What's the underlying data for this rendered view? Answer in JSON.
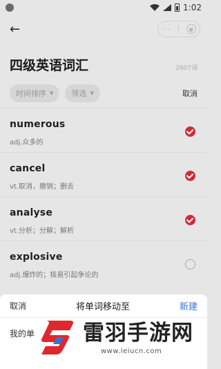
{
  "status": {
    "time": "1:02"
  },
  "header": {
    "back_icon": "back-arrow-icon"
  },
  "page": {
    "title": "四级英语词汇",
    "count": "2607词"
  },
  "filters": {
    "sort_label": "时间排序",
    "filter_label": "筛选",
    "cancel_label": "取消"
  },
  "words": [
    {
      "word": "numerous",
      "meaning": "adj.众多的",
      "checked": true
    },
    {
      "word": "cancel",
      "meaning": "vt.取消，撤销；删去",
      "checked": true
    },
    {
      "word": "analyse",
      "meaning": "vt.分析；分解；解析",
      "checked": true
    },
    {
      "word": "explosive",
      "meaning": "adj.爆炸的；极易引起争论的",
      "checked": false
    }
  ],
  "sheet": {
    "cancel_label": "取消",
    "title": "将单词移动至",
    "new_label": "新建",
    "first_item": "我的单"
  },
  "watermark": {
    "title": "雷羽手游网",
    "url": "www.leiucn.com"
  },
  "colors": {
    "accent_red": "#d12b3a",
    "link_blue": "#3a6fd8"
  }
}
